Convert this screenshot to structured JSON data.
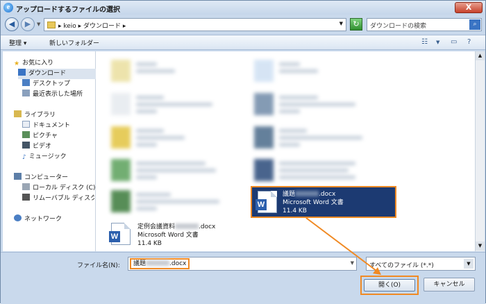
{
  "window": {
    "title": "アップロードするファイルの選択",
    "close_label": "X"
  },
  "nav": {
    "back_glyph": "◀",
    "forward_glyph": "▶",
    "address_path": "▸ keio ▸ ダウンロード ▸",
    "refresh_glyph": "↻"
  },
  "search": {
    "placeholder": "ダウンロードの検索",
    "button_glyph": "⌕"
  },
  "toolbar": {
    "organize_label": "整理 ▾",
    "new_folder_label": "新しいフォルダー"
  },
  "sidebar": {
    "favorites_label": "お気に入り",
    "favorites": [
      "ダウンロード",
      "デスクトップ",
      "最近表示した場所"
    ],
    "libraries_label": "ライブラリ",
    "libraries": [
      "ドキュメント",
      "ピクチャ",
      "ビデオ",
      "ミュージック"
    ],
    "computer_label": "コンピューター",
    "computer_items": [
      "ローカル ディスク (C)",
      "リムーバブル ディスク (E"
    ],
    "network_label": "ネットワーク"
  },
  "files": {
    "selected": {
      "name_prefix": "議題",
      "name_suffix": ".docx",
      "type": "Microsoft Word 文書",
      "size": "11.4 KB"
    },
    "other": {
      "name_prefix": "定例会議資料",
      "name_suffix": ".docx",
      "type": "Microsoft Word 文書",
      "size": "11.4 KB"
    },
    "word_glyph": "W"
  },
  "bottom": {
    "filename_label": "ファイル名(N):",
    "filename_prefix": "議題",
    "filename_suffix": ".docx",
    "filetype_value": "すべてのファイル (*.*)",
    "open_label": "開く(O)",
    "cancel_label": "キャンセル"
  },
  "colors": {
    "accent": "#f08a24",
    "selection": "#1c3a72"
  }
}
